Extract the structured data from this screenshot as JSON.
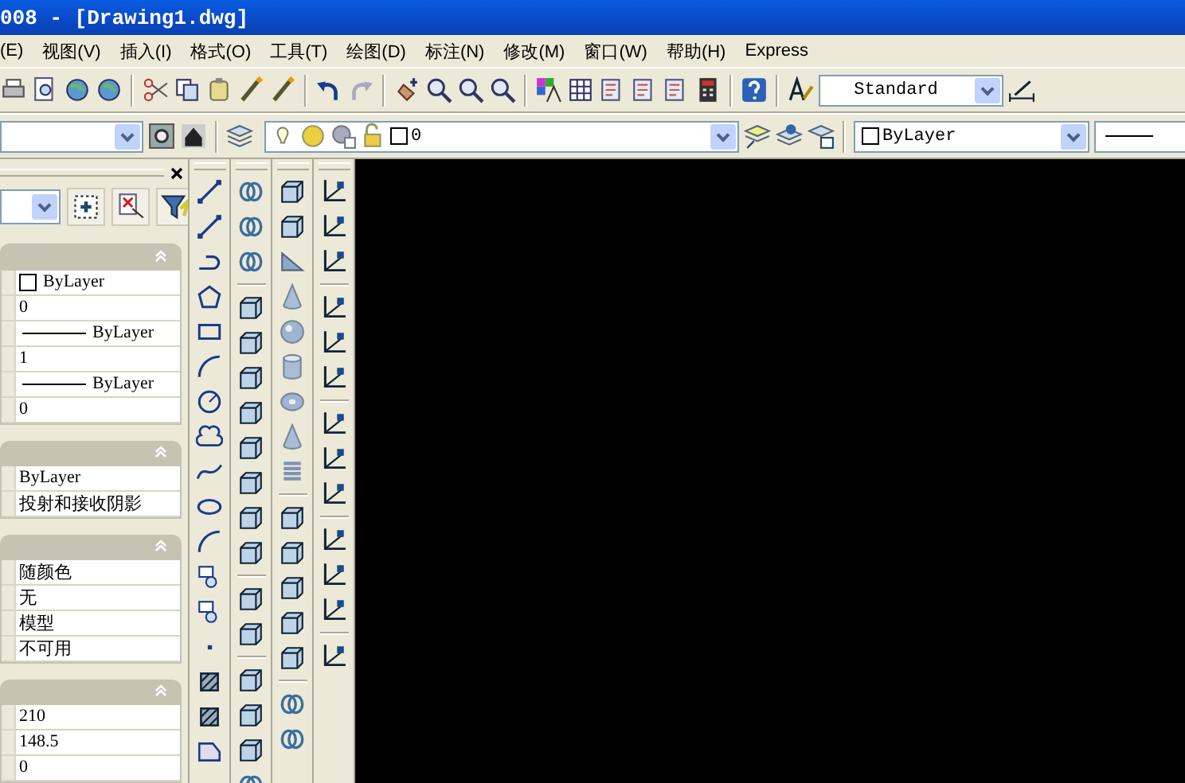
{
  "window": {
    "title": "008 - [Drawing1.dwg]"
  },
  "menu_bar": [
    {
      "label": "(E)"
    },
    {
      "label": "视图(V)"
    },
    {
      "label": "插入(I)"
    },
    {
      "label": "格式(O)"
    },
    {
      "label": "工具(T)"
    },
    {
      "label": "绘图(D)"
    },
    {
      "label": "标注(N)"
    },
    {
      "label": "修改(M)"
    },
    {
      "label": "窗口(W)"
    },
    {
      "label": "帮助(H)"
    },
    {
      "label": "Express"
    }
  ],
  "standard_toolbar": {
    "text_style": "Standard"
  },
  "layers_toolbar": {
    "layer": "0"
  },
  "properties_toolbar": {
    "color_setting": "ByLayer"
  },
  "properties_palette": {
    "sections": [
      {
        "rows": [
          {
            "kind": "color",
            "value": "ByLayer"
          },
          {
            "kind": "text",
            "value": "0"
          },
          {
            "kind": "linetype",
            "value": "ByLayer"
          },
          {
            "kind": "text",
            "value": "1"
          },
          {
            "kind": "linetype",
            "value": "ByLayer"
          },
          {
            "kind": "text",
            "value": "0"
          }
        ]
      },
      {
        "rows": [
          {
            "kind": "text",
            "value": "ByLayer"
          },
          {
            "kind": "text",
            "value": "投射和接收阴影"
          }
        ]
      },
      {
        "rows": [
          {
            "kind": "text",
            "value": "随颜色"
          },
          {
            "kind": "text",
            "value": "无"
          },
          {
            "kind": "text",
            "value": "模型"
          },
          {
            "kind": "text",
            "value": "不可用"
          }
        ]
      },
      {
        "rows": [
          {
            "kind": "text",
            "value": "210"
          },
          {
            "kind": "text",
            "value": "148.5"
          },
          {
            "kind": "text",
            "value": "0"
          }
        ]
      }
    ]
  }
}
